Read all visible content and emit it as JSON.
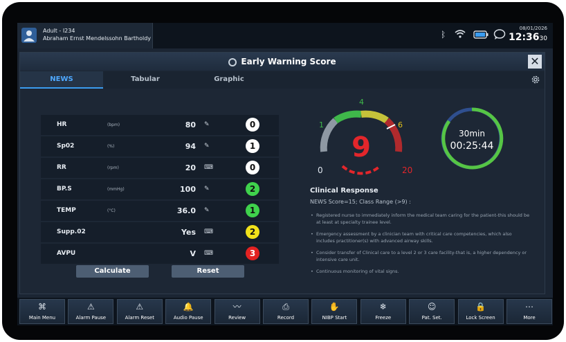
{
  "patient": {
    "type": "Adult - I234",
    "name": "Abraham Ernst Mendelssohn Bartholdy"
  },
  "status": {
    "date": "08/01/2026",
    "time": "12:36",
    "seconds": "30"
  },
  "dialog": {
    "title": "Early Warning Score",
    "tabs": [
      "NEWS",
      "Tabular",
      "Graphic"
    ],
    "active_tab": "NEWS"
  },
  "parameters": [
    {
      "name": "HR",
      "unit": "(bpm)",
      "value": "80",
      "input": "pen",
      "score": "0",
      "score_color": "#ffffff"
    },
    {
      "name": "Sp02",
      "unit": "(%)",
      "value": "94",
      "input": "pen",
      "score": "1",
      "score_color": "#ffffff"
    },
    {
      "name": "RR",
      "unit": "(rpm)",
      "value": "20",
      "input": "keyboard",
      "score": "0",
      "score_color": "#ffffff"
    },
    {
      "name": "BP.S",
      "unit": "(mmHg)",
      "value": "100",
      "input": "pen",
      "score": "2",
      "score_color": "#3fd24c"
    },
    {
      "name": "TEMP",
      "unit": "(°C)",
      "value": "36.0",
      "input": "pen",
      "score": "1",
      "score_color": "#3fd24c"
    },
    {
      "name": "Supp.02",
      "unit": "",
      "value": "Yes",
      "input": "keyboard",
      "score": "2",
      "score_color": "#f2e21a"
    },
    {
      "name": "AVPU",
      "unit": "",
      "value": "V",
      "input": "keyboard",
      "score": "3",
      "score_color": "#e32222"
    }
  ],
  "buttons": {
    "calculate": "Calculate",
    "reset": "Reset"
  },
  "gauge": {
    "score": "9",
    "min": "0",
    "max": "20",
    "ticks": [
      "1",
      "4",
      "6"
    ],
    "score_color": "#e3262b"
  },
  "timer": {
    "interval": "30min",
    "countdown": "00:25:44"
  },
  "clinical_response": {
    "title": "Clinical Response",
    "subtitle": "NEWS Score=15; Class Range (>9) :",
    "items": [
      "Registered nurse to immediately inform the medical team caring for the patient-this should be at least at specialty trainee level.",
      "Emergency assessment by a clinician team with critical care competencies, which also includes practitioner(s) with advanced airway skills.",
      "Consider transfer of Clinical care to a level 2 or 3 care facility-that is, a higher dependency or intensive care unit.",
      "Continuous monitoring of vital signs."
    ]
  },
  "toolbar": [
    {
      "label": "Main Menu",
      "icon": "grid-icon",
      "glyph": "⌘"
    },
    {
      "label": "Alarm Pause",
      "icon": "alarm-pause-icon",
      "glyph": "⚠"
    },
    {
      "label": "Alarm Reset",
      "icon": "alarm-reset-icon",
      "glyph": "⚠"
    },
    {
      "label": "Audio Pause",
      "icon": "audio-pause-icon",
      "glyph": "🔔"
    },
    {
      "label": "Review",
      "icon": "review-icon",
      "glyph": "〰"
    },
    {
      "label": "Record",
      "icon": "record-icon",
      "glyph": "⎙"
    },
    {
      "label": "NIBP Start",
      "icon": "nibp-icon",
      "glyph": "✋"
    },
    {
      "label": "Freeze",
      "icon": "freeze-icon",
      "glyph": "❄"
    },
    {
      "label": "Pat. Set.",
      "icon": "patient-icon",
      "glyph": "☺"
    },
    {
      "label": "Lock Screen",
      "icon": "lock-icon",
      "glyph": "🔒"
    },
    {
      "label": "More",
      "icon": "more-icon",
      "glyph": "⋯"
    }
  ]
}
